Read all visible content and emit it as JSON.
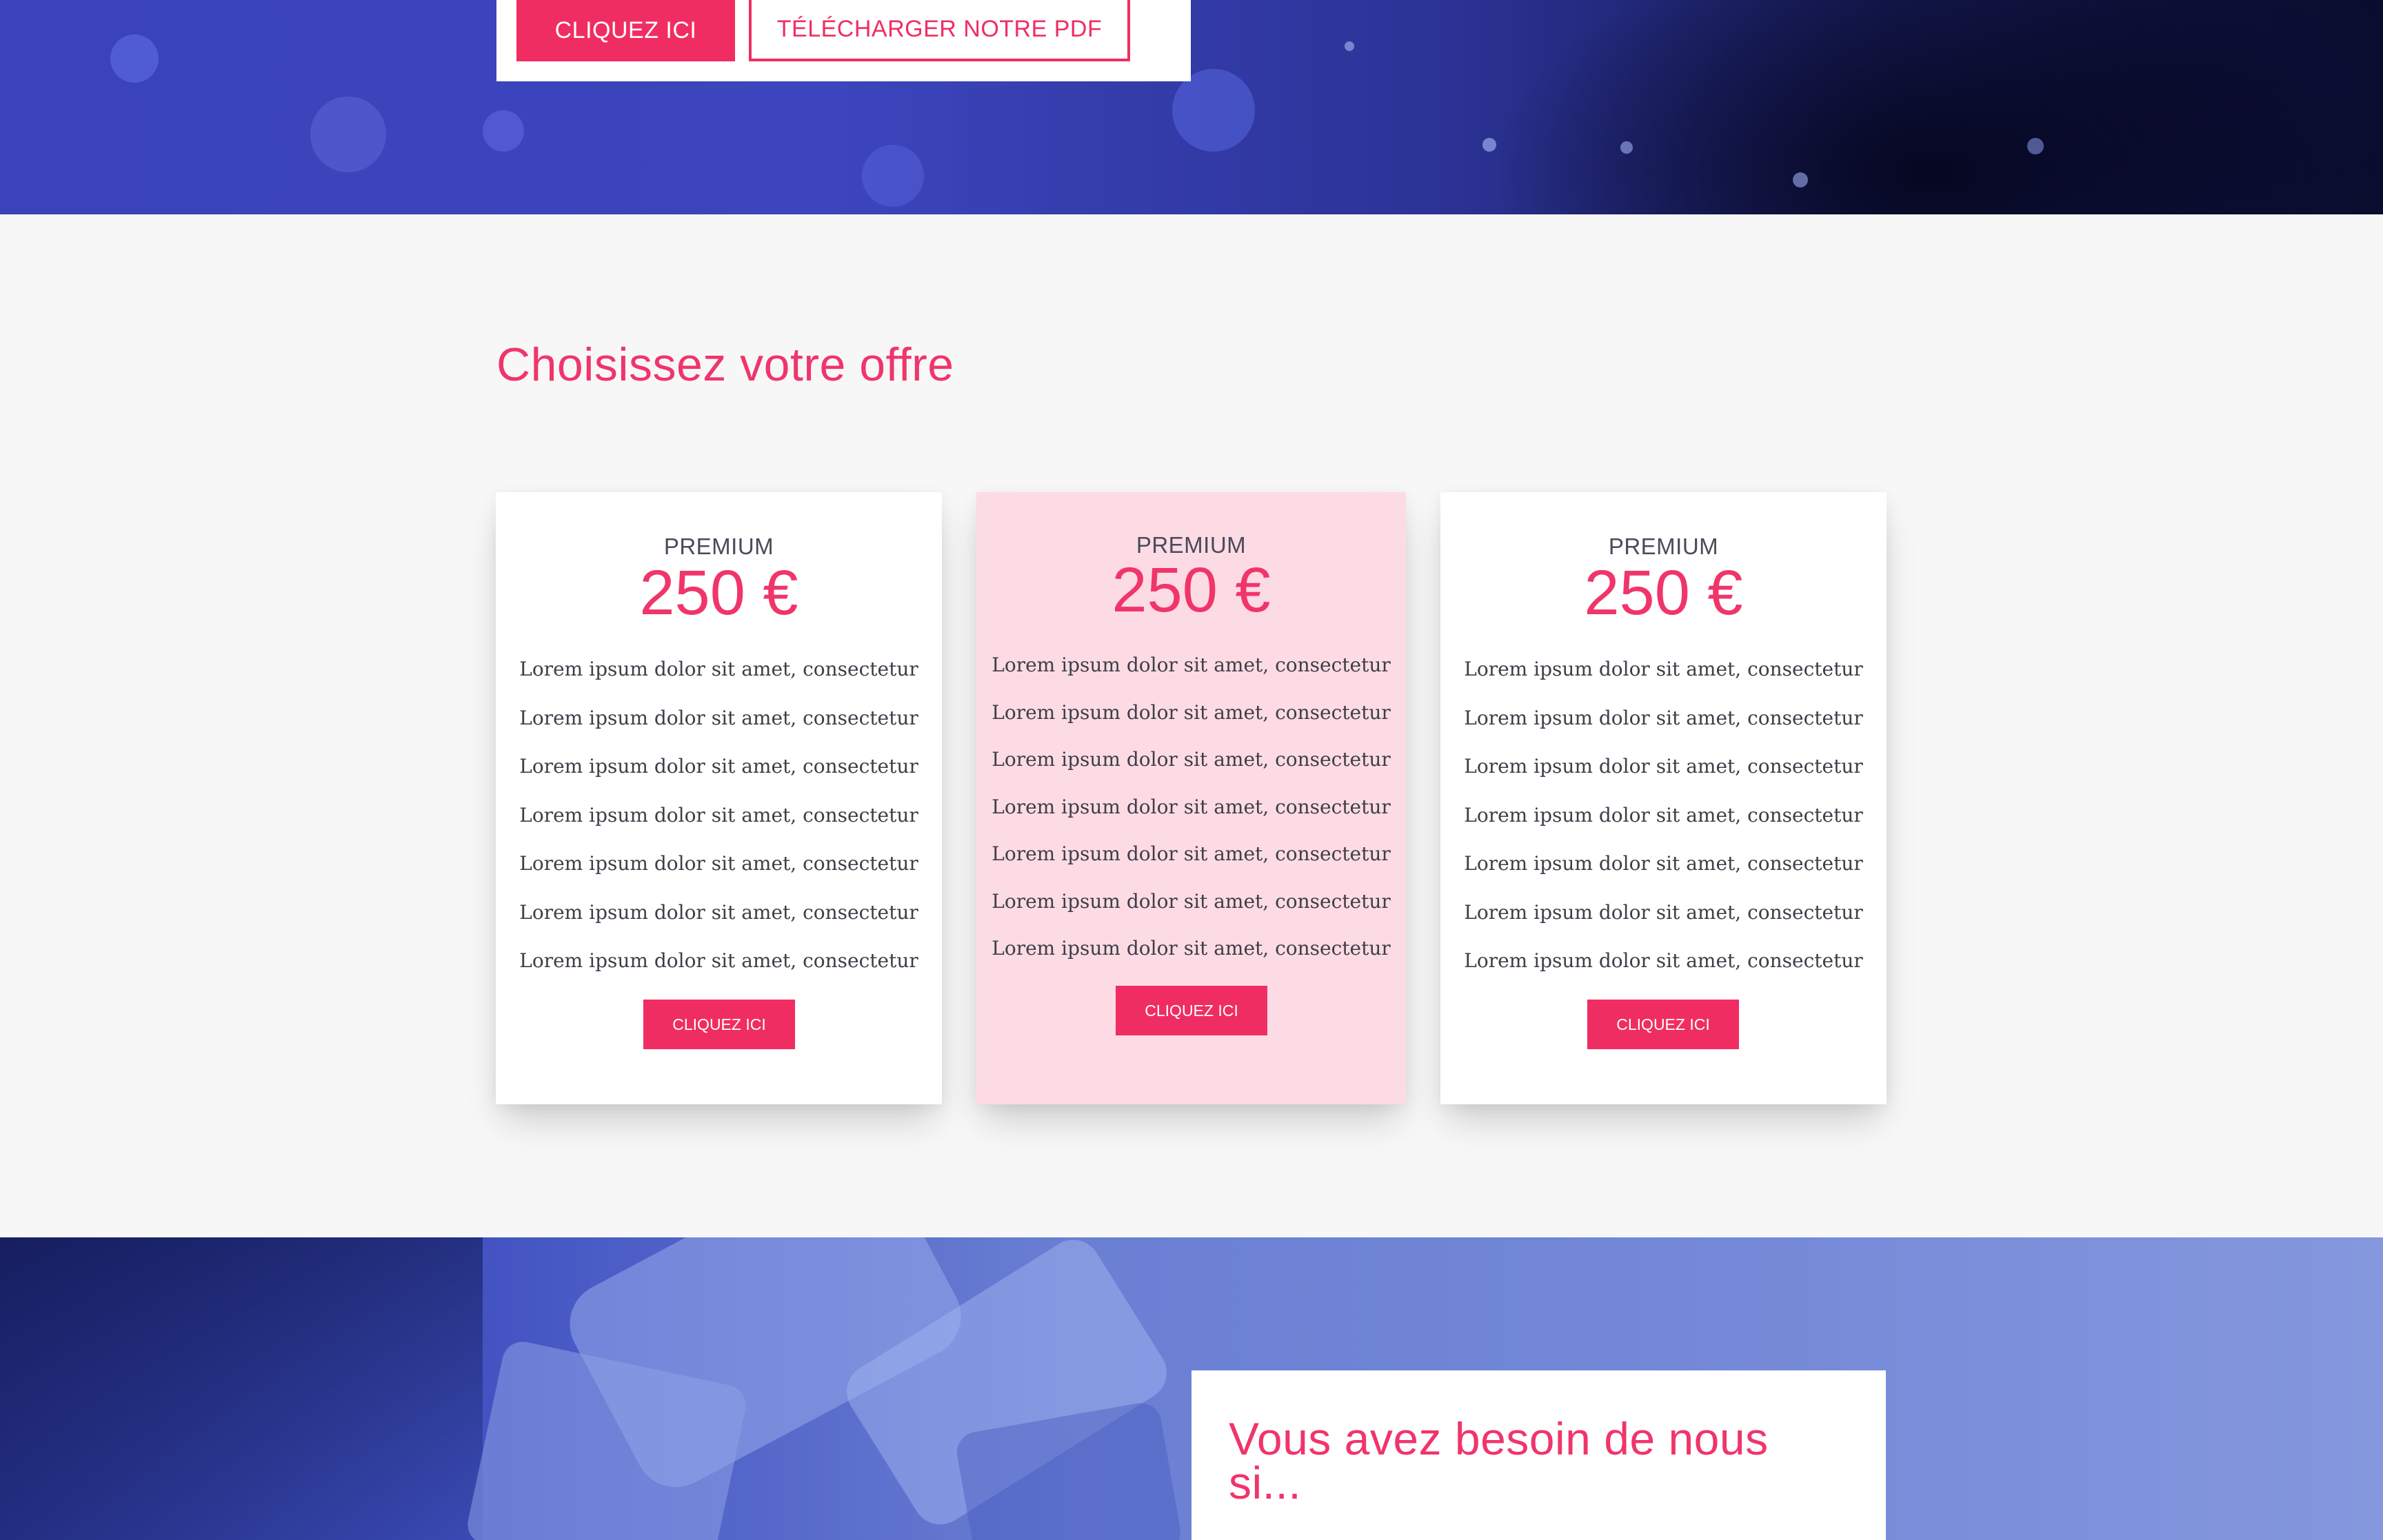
{
  "hero": {
    "primary_button": "CLIQUEZ ICI",
    "pdf_button": "TÉLÉCHARGER NOTRE PDF"
  },
  "pricing": {
    "title": "Choisissez votre offre",
    "plans": [
      {
        "name": "PREMIUM",
        "price": "250 €",
        "features": [
          "Lorem ipsum dolor sit amet, consectetur",
          "Lorem ipsum dolor sit amet, consectetur",
          "Lorem ipsum dolor sit amet, consectetur",
          "Lorem ipsum dolor sit amet, consectetur",
          "Lorem ipsum dolor sit amet, consectetur",
          "Lorem ipsum dolor sit amet, consectetur",
          "Lorem ipsum dolor sit amet, consectetur"
        ],
        "button": "CLIQUEZ ICI"
      },
      {
        "name": "PREMIUM",
        "price": "250 €",
        "features": [
          "Lorem ipsum dolor sit amet, consectetur",
          "Lorem ipsum dolor sit amet, consectetur",
          "Lorem ipsum dolor sit amet, consectetur",
          "Lorem ipsum dolor sit amet, consectetur",
          "Lorem ipsum dolor sit amet, consectetur",
          "Lorem ipsum dolor sit amet, consectetur",
          "Lorem ipsum dolor sit amet, consectetur"
        ],
        "button": "CLIQUEZ ICI"
      },
      {
        "name": "PREMIUM",
        "price": "250 €",
        "features": [
          "Lorem ipsum dolor sit amet, consectetur",
          "Lorem ipsum dolor sit amet, consectetur",
          "Lorem ipsum dolor sit amet, consectetur",
          "Lorem ipsum dolor sit amet, consectetur",
          "Lorem ipsum dolor sit amet, consectetur",
          "Lorem ipsum dolor sit amet, consectetur",
          "Lorem ipsum dolor sit amet, consectetur"
        ],
        "button": "CLIQUEZ ICI"
      }
    ]
  },
  "contact": {
    "title": "Vous avez besoin de nous si..."
  },
  "colors": {
    "accent": "#f02d62",
    "featured_card": "#fddbe4",
    "hero_blue": "#3a43b9",
    "section_bg": "#f7f7f7"
  }
}
